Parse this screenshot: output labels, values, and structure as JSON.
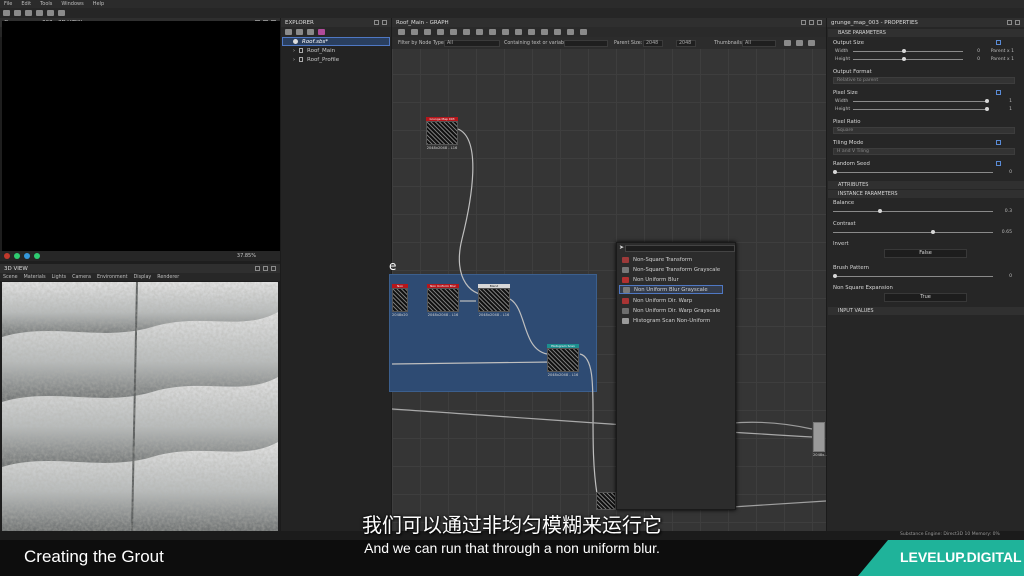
{
  "menu": [
    "File",
    "Edit",
    "Tools",
    "Windows",
    "Help"
  ],
  "view2d": {
    "title": "Grunge_map_003 - 2D VIEW",
    "zoom": "37.85%"
  },
  "view3d": {
    "title": "3D VIEW",
    "menu": [
      "Scene",
      "Materials",
      "Lights",
      "Camera",
      "Environment",
      "Display",
      "Renderer"
    ]
  },
  "explorer": {
    "title": "EXPLORER",
    "package": "Roof.sbs*",
    "graphs": [
      "Roof_Main",
      "Roof_Profile"
    ]
  },
  "graph": {
    "title": "Roof_Main - GRAPH",
    "filter_label": "Filter by Node Type",
    "filter_value": "All",
    "text_label": "Containing text or variable",
    "parent_size_label": "Parent Size:",
    "parent_size_value": "2048",
    "second_size_value": "2048",
    "thumbnails_label": "Thumbnails:",
    "thumbnails_value": "All",
    "frame_label": "e",
    "nodes": [
      {
        "name": "Grunge Map 003",
        "size": "2048x2048 - L16",
        "color": "#b5161b"
      },
      {
        "name": "Non Uniform Blur",
        "size": "2048x2048 - L16",
        "color": "#b5161b"
      },
      {
        "name": "Non Uniform Blur",
        "size": "2048x2048 - L16",
        "color": "#b5161b"
      },
      {
        "name": "Blend",
        "size": "2048x2048 - L16",
        "color": "#d8d8d8"
      },
      {
        "name": "Histogram Scan",
        "size": "2048x2048 - L16",
        "color": "#1c8f8f"
      },
      {
        "name": "",
        "size": "2048x...",
        "color": "#9a9a9a"
      }
    ]
  },
  "popup": {
    "items": [
      {
        "label": "Non-Square Transform",
        "icon_color": "#9c3a3a"
      },
      {
        "label": "Non-Square Transform Grayscale",
        "icon_color": "#777777"
      },
      {
        "label": "Non Uniform Blur",
        "icon_color": "#b23030"
      },
      {
        "label": "Non Uniform Blur Grayscale",
        "icon_color": "#7a7a7a"
      },
      {
        "label": "Non Uniform Dir. Warp",
        "icon_color": "#a83434"
      },
      {
        "label": "Non Uniform Dir. Warp Grayscale",
        "icon_color": "#6e6e6e"
      },
      {
        "label": "Histogram Scan Non-Uniform",
        "icon_color": "#9b9b9b"
      }
    ],
    "selected_index": 3
  },
  "properties": {
    "title": "grunge_map_003 - PROPERTIES",
    "base_section": "BASE PARAMETERS",
    "output_size": "Output Size",
    "width": "Width",
    "height": "Height",
    "width_val": "0",
    "height_val": "0",
    "parent_x1": "Parent x 1",
    "output_format": "Output Format",
    "output_format_value": "Relative to parent",
    "pixel_size": "Pixel Size",
    "pixel_w_val": "1",
    "pixel_h_val": "1",
    "pixel_ratio": "Pixel Ratio",
    "pixel_ratio_value": "Square",
    "tiling_mode": "Tiling Mode",
    "tiling_mode_value": "H and V Tiling",
    "random_seed": "Random Seed",
    "random_seed_val": "0",
    "attributes_section": "ATTRIBUTES",
    "instance_section": "INSTANCE PARAMETERS",
    "balance": "Balance",
    "balance_val": "0.3",
    "contrast": "Contrast",
    "contrast_val": "0.65",
    "invert": "Invert",
    "invert_value": "False",
    "brush_pattern": "Brush Pattern",
    "brush_pattern_val": "0",
    "non_square": "Non Square Expansion",
    "non_square_value": "True",
    "input_section": "INPUT VALUES"
  },
  "status": "Substance Engine: Direct3D 10    Memory: 0%",
  "captions": {
    "chinese": "我们可以通过非均匀模糊来运行它",
    "english": "And we can run that through a non uniform blur."
  },
  "lesson_title": "Creating the Grout",
  "brand": "LEVELUP.DIGITAL",
  "colors": {
    "accent": "#2e4b73",
    "brand": "#1fb39a"
  }
}
